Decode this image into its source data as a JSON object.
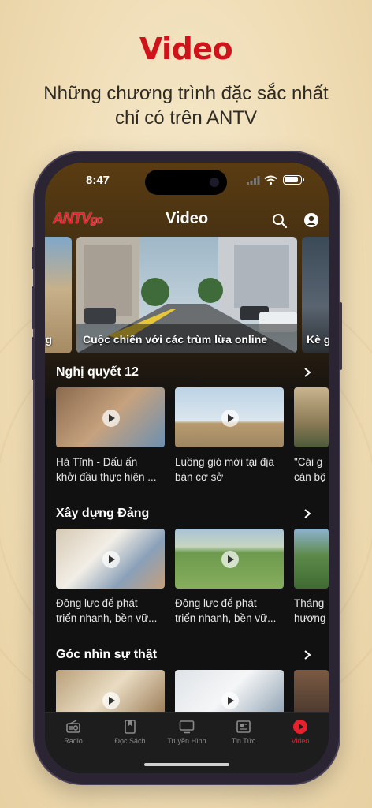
{
  "promo": {
    "headline": "Video",
    "subline_1": "Những chương trình đặc sắc nhất",
    "subline_2": "chỉ có trên ANTV"
  },
  "status": {
    "time": "8:47"
  },
  "app": {
    "logo_main": "ANTV",
    "logo_sub": "go",
    "title": "Video",
    "icons": {
      "search": "search-icon",
      "user": "user-icon"
    }
  },
  "hero": {
    "left_caption": "ng",
    "main_caption": "Cuộc chiến với các trùm lừa online",
    "right_caption": "Kè g"
  },
  "sections": [
    {
      "title": "Nghị quyết 12",
      "items": [
        {
          "line1": "Hà Tĩnh - Dấu ấn",
          "line2": "khởi đầu thực hiện ..."
        },
        {
          "line1": "Luồng gió mới tại địa",
          "line2": "bàn cơ sở"
        },
        {
          "line1": "\"Cái g",
          "line2": "cán bộ"
        }
      ]
    },
    {
      "title": "Xây dựng Đảng",
      "items": [
        {
          "line1": "Động lực để phát",
          "line2": "triển nhanh, bền vữ..."
        },
        {
          "line1": "Động lực để phát",
          "line2": "triển nhanh, bền vữ..."
        },
        {
          "line1": "Tháng",
          "line2": "hương"
        }
      ]
    },
    {
      "title": "Góc nhìn sự thật",
      "items": [
        {
          "line1": "",
          "line2": ""
        },
        {
          "line1": "",
          "line2": ""
        },
        {
          "line1": "",
          "line2": ""
        }
      ]
    }
  ],
  "tabs": [
    {
      "label": "Radio",
      "icon": "radio-icon"
    },
    {
      "label": "Đọc Sách",
      "icon": "book-icon"
    },
    {
      "label": "Truyền Hình",
      "icon": "tv-icon"
    },
    {
      "label": "Tin Tức",
      "icon": "newspaper-icon"
    },
    {
      "label": "Video",
      "icon": "video-play-icon",
      "active": true
    }
  ],
  "colors": {
    "brand_red": "#d0121b",
    "accent": "#e8212c",
    "tab_bg": "#1d1d1d"
  }
}
